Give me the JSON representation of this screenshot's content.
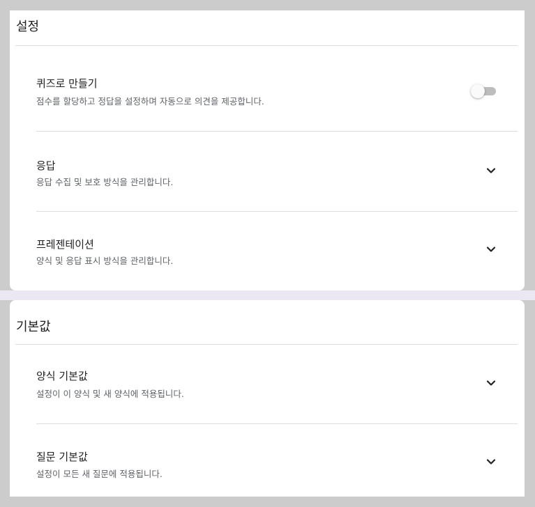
{
  "settings": {
    "title": "설정",
    "quiz": {
      "title": "퀴즈로 만들기",
      "description": "점수를 할당하고 정답을 설정하며 자동으로 의견을 제공합니다.",
      "toggle_on": false
    },
    "responses": {
      "title": "응답",
      "description": "응답 수집 및 보호 방식을 관리합니다.",
      "icon": "chevron-down-icon"
    },
    "presentation": {
      "title": "프레젠테이션",
      "description": "양식 및 응답 표시 방식을 관리합니다.",
      "icon": "chevron-down-icon"
    }
  },
  "defaults": {
    "title": "기본값",
    "form_defaults": {
      "title": "양식 기본값",
      "description": "설정이 이 양식 및 새 양식에 적용됩니다.",
      "icon": "chevron-down-icon"
    },
    "question_defaults": {
      "title": "질문 기본값",
      "description": "설정이 모든 새 질문에 적용됩니다.",
      "icon": "chevron-down-icon"
    }
  },
  "colors": {
    "background": "#cccccc",
    "card": "#ffffff",
    "band": "#ebe8f3",
    "divider": "#dadce0",
    "text_primary": "#202124",
    "text_secondary": "#5f6368",
    "toggle_track": "#bdbdbd"
  }
}
